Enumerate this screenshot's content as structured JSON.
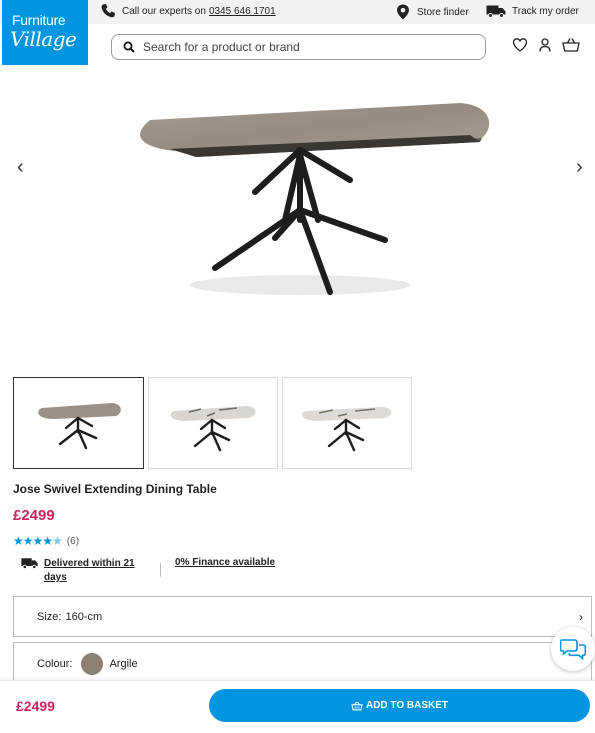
{
  "brand": {
    "line1": "Furniture",
    "line2": "Village"
  },
  "topbar": {
    "call_prefix": "Call our experts on",
    "phone": "0345 646 1701",
    "store_finder": "Store finder",
    "track_order": "Track my order"
  },
  "search": {
    "placeholder": "Search for a product or brand",
    "value": ""
  },
  "gallery": {
    "prev": "‹",
    "next": "›",
    "thumbnails": 3,
    "active_index": 0
  },
  "product": {
    "title": "Jose Swivel Extending Dining Table",
    "price": "£2499",
    "rating": 4.5,
    "review_count": "(6)",
    "delivery": "Delivered within 21 days",
    "finance": "0% Finance available"
  },
  "options": {
    "size_label": "Size:",
    "size_value": "160-cm",
    "colour_label": "Colour:",
    "colour_value": "Argile",
    "colour_swatch": "#8c7f74"
  },
  "footer": {
    "price": "£2499",
    "add_to_basket": "ADD TO BASKET"
  },
  "colors": {
    "accent": "#0095e0",
    "price": "#d0235b"
  },
  "icons": [
    "phone-icon",
    "location-pin-icon",
    "delivery-truck-icon",
    "search-icon",
    "heart-icon",
    "account-icon",
    "basket-icon",
    "chat-icon"
  ]
}
